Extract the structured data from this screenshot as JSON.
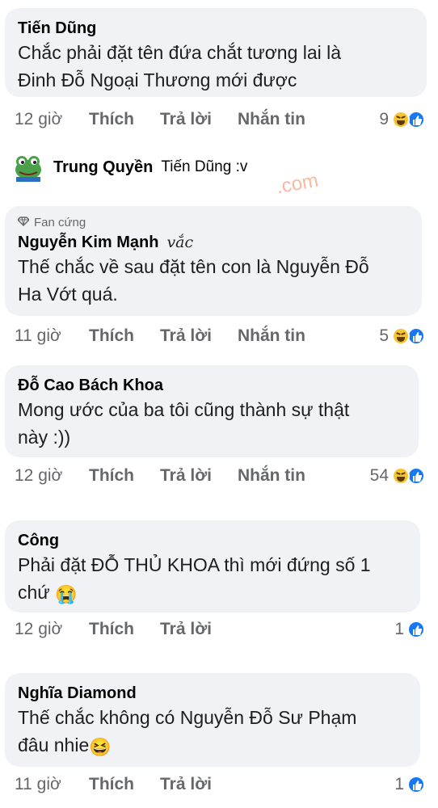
{
  "comments": [
    {
      "author": "Tiến Dũng",
      "text_line1": "Chắc phải đặt tên đứa chắt tương lai là",
      "text_line2": "Đinh Đỗ Ngoại Thương mới được",
      "time": "12 giờ",
      "like": "Thích",
      "reply": "Trả lời",
      "message": "Nhắn tin",
      "reaction_count": "9"
    },
    {
      "badge": "Fan cứng",
      "author": "Nguyễn Kim Mạnh",
      "handwriting": "vắc",
      "text_line1": "Thế chắc về sau đặt tên con là Nguyễn Đỗ",
      "text_line2": "Ha Vớt quá.",
      "time": "11 giờ",
      "like": "Thích",
      "reply": "Trả lời",
      "message": "Nhắn tin",
      "reaction_count": "5"
    },
    {
      "author": "Đỗ Cao Bách Khoa",
      "text_line1": "Mong ước của ba tôi cũng thành sự thật",
      "text_line2": "này :))",
      "time": "12 giờ",
      "like": "Thích",
      "reply": "Trả lời",
      "message": "Nhắn tin",
      "reaction_count": "54"
    },
    {
      "author": "Công",
      "text_line1": "Phải đặt ĐỖ THỦ KHOA thì mới đứng số 1",
      "text_line2": "chứ",
      "emoji": "😭",
      "time": "12 giờ",
      "like": "Thích",
      "reply": "Trả lời",
      "reaction_count": "1"
    },
    {
      "author": "Nghĩa Diamond",
      "text_line1": "Thế chắc không có Nguyễn Đỗ Sư Phạm",
      "text_line2": "đâu nhie",
      "emoji": "😆",
      "time": "11 giờ",
      "like": "Thích",
      "reply": "Trả lời",
      "reaction_count": "1"
    }
  ],
  "reply": {
    "author": "Trung Quyền",
    "text": "Tiến Dũng :v"
  },
  "watermark": ".com",
  "colors": {
    "bubble": "#f0f2f5",
    "like_blue": "#1877f2",
    "haha_yellow": "#f7c531",
    "meta_gray": "#65676b"
  }
}
